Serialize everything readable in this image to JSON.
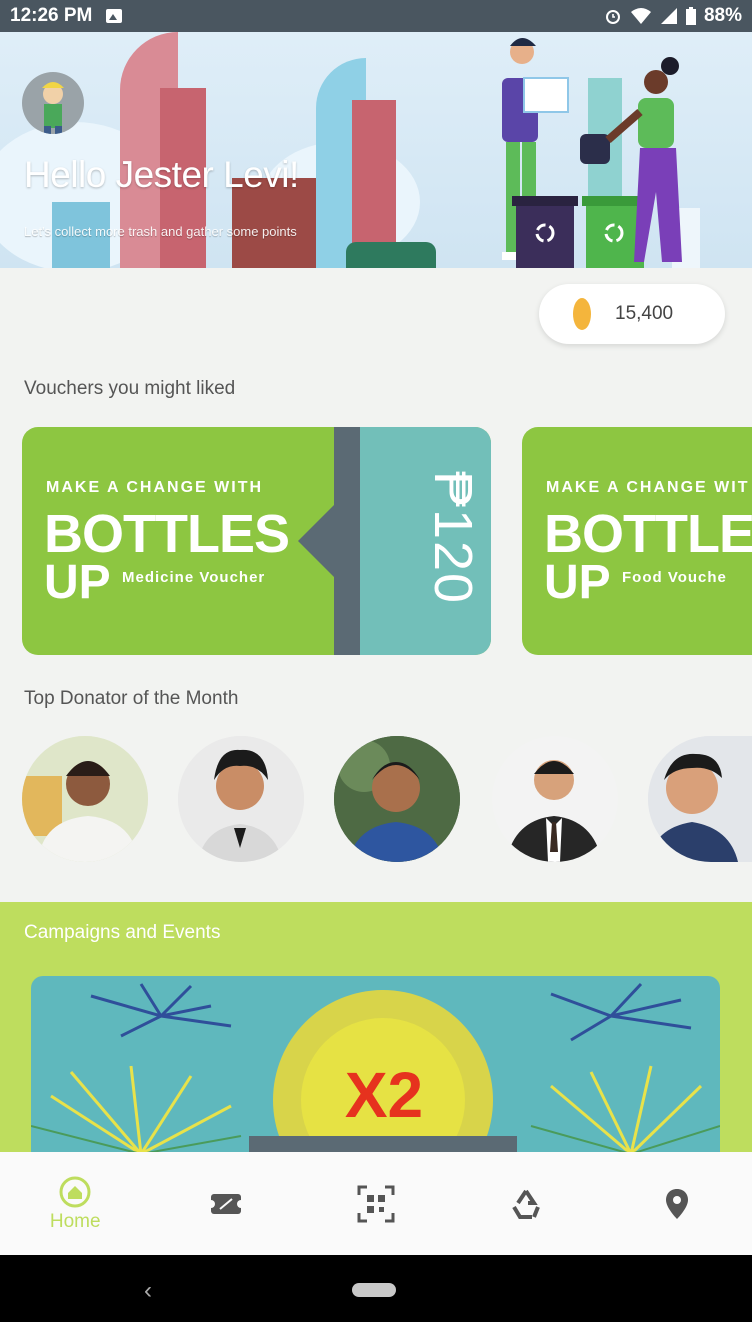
{
  "status_bar": {
    "time": "12:26 PM",
    "battery": "88%"
  },
  "hero": {
    "greeting": "Hello Jester Levi!",
    "subtitle": "Let's collect more trash and gather some points"
  },
  "points": {
    "value": "15,400"
  },
  "vouchers": {
    "title": "Vouchers you might liked",
    "items": [
      {
        "tagline": "MAKE A CHANGE WITH",
        "brand_line1": "BOTTLES",
        "brand_line2": "UP",
        "type": "Medicine Voucher",
        "price": "₱120"
      },
      {
        "tagline": "MAKE A CHANGE WIT",
        "brand_line1": "BOTTLES",
        "brand_line2": "UP",
        "type": "Food Vouche"
      }
    ]
  },
  "donators": {
    "title": "Top Donator of the Month"
  },
  "campaigns": {
    "title": "Campaigns and Events",
    "banner_text": "X2"
  },
  "bottom_nav": {
    "home_label": "Home"
  },
  "colors": {
    "accent": "#bedd5e",
    "voucher_green": "#8dc641",
    "voucher_teal": "#72bfb9",
    "status_bar": "#4a5660"
  }
}
